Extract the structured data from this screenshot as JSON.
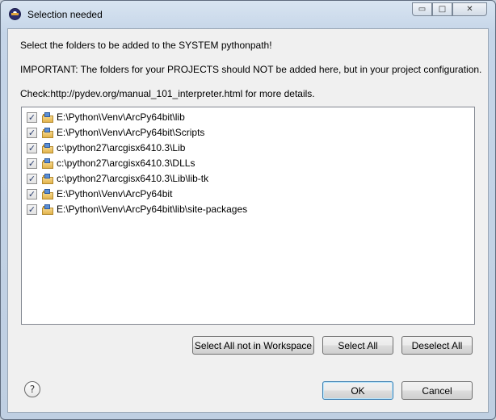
{
  "window": {
    "title": "Selection needed",
    "controls": {
      "minimize": "▭",
      "maximize": "□",
      "close": "✕"
    }
  },
  "message": {
    "line1": "Select the folders to be added to the SYSTEM pythonpath!",
    "line2": "IMPORTANT: The folders for your PROJECTS should NOT be added here, but in your project configuration.",
    "line3": "Check:http://pydev.org/manual_101_interpreter.html for more details."
  },
  "folders": [
    {
      "path": "E:\\Python\\Venv\\ArcPy64bit\\lib",
      "checked": true
    },
    {
      "path": "E:\\Python\\Venv\\ArcPy64bit\\Scripts",
      "checked": true
    },
    {
      "path": "c:\\python27\\arcgisx6410.3\\Lib",
      "checked": true
    },
    {
      "path": "c:\\python27\\arcgisx6410.3\\DLLs",
      "checked": true
    },
    {
      "path": "c:\\python27\\arcgisx6410.3\\Lib\\lib-tk",
      "checked": true
    },
    {
      "path": "E:\\Python\\Venv\\ArcPy64bit",
      "checked": true
    },
    {
      "path": "E:\\Python\\Venv\\ArcPy64bit\\lib\\site-packages",
      "checked": true
    }
  ],
  "check_glyph": "✓",
  "buttons": {
    "select_all_not_in_workspace": "Select All not in Workspace",
    "select_all": "Select All",
    "deselect_all": "Deselect All",
    "ok": "OK",
    "cancel": "Cancel",
    "help": "?"
  },
  "icons": {
    "app": "eclipse-icon",
    "folder": "python-folder-icon",
    "help": "help-icon"
  },
  "colors": {
    "frame": "#c5d5e8",
    "client": "#f0f0f0",
    "default_button_border": "#3c7fb1"
  }
}
